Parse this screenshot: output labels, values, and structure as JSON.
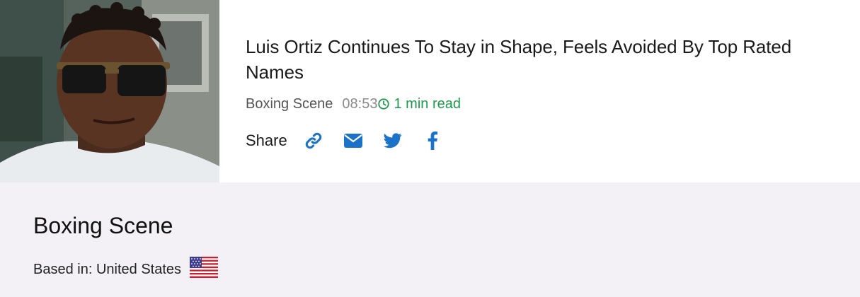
{
  "article": {
    "headline": "Luis Ortiz Continues To Stay in Shape, Feels Avoided By Top Rated Names",
    "source": "Boxing Scene",
    "time": "08:53",
    "read_time": "1 min read",
    "share_label": "Share",
    "share_icons": [
      "link-icon",
      "envelope-icon",
      "twitter-icon",
      "facebook-icon"
    ]
  },
  "source_panel": {
    "name": "Boxing Scene",
    "based_in": "Based in: United States",
    "flag_icon": "us-flag-icon"
  },
  "colors": {
    "accent_blue": "#1a73c8",
    "read_green": "#1a9a4a",
    "panel_bg": "#f3f1f5"
  }
}
